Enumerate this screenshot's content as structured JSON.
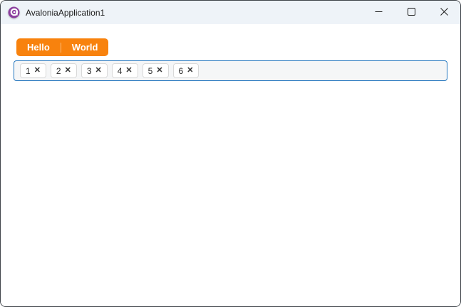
{
  "window": {
    "title": "AvaloniaApplication1"
  },
  "titlebar": {
    "icons": {
      "app_logo": "avalonia-logo",
      "minimize": "minimize-icon",
      "maximize": "maximize-icon",
      "close": "close-icon"
    }
  },
  "tabs": {
    "accent_color": "#f8820d",
    "items": [
      {
        "label": "Hello"
      },
      {
        "label": "World"
      }
    ]
  },
  "chipbox": {
    "border_color": "#2577be",
    "background_color": "#f5f6f7",
    "remove_glyph": "✕",
    "chips": [
      {
        "label": "1"
      },
      {
        "label": "2"
      },
      {
        "label": "3"
      },
      {
        "label": "4"
      },
      {
        "label": "5"
      },
      {
        "label": "6"
      }
    ]
  },
  "colors": {
    "titlebar_background": "#eef3f8",
    "window_border": "#3f444a",
    "logo_purple": "#8b3e9e"
  }
}
